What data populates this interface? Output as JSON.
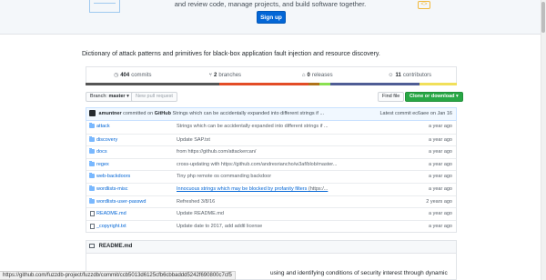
{
  "banner": {
    "text": "and review code, manage projects, and build software together.",
    "signup_label": "Sign up"
  },
  "description": "Dictionary of attack patterns and primitives for black-box application fault injection and resource discovery.",
  "stats": {
    "commits_count": "404",
    "commits_label": "commits",
    "branches_count": "2",
    "branches_label": "branches",
    "releases_count": "0",
    "releases_label": "releases",
    "contributors_count": "11",
    "contributors_label": "contributors"
  },
  "language_colors": [
    "#555555",
    "#e34c26",
    "#b07219",
    "#89e051",
    "#4F5D95",
    "#f1e05a"
  ],
  "toolbar": {
    "branch_label": "Branch:",
    "branch_value": "master",
    "new_pr_label": "New pull request",
    "find_file_label": "Find file",
    "clone_label": "Clone or download"
  },
  "latest_commit": {
    "author": "amuntner",
    "committed_text": "committed on",
    "via": "GitHub",
    "message": "Strings which can be accidentally expanded into different strings if ...",
    "latest_label": "Latest commit",
    "sha": "ec6aee",
    "date": "on Jan 16"
  },
  "files": [
    {
      "name": "attack",
      "type": "dir",
      "message": "Strings which can be accidentally expanded into different strings if ...",
      "age": "a year ago"
    },
    {
      "name": "discovery",
      "type": "dir",
      "message": "Update SAP.txt",
      "age": "a year ago"
    },
    {
      "name": "docs",
      "type": "dir",
      "message": "from https://github.com/attackercan/",
      "age": "a year ago"
    },
    {
      "name": "regex",
      "type": "dir",
      "message": "cross-updating with https://github.com/andresriancho/w3af/blob/master...",
      "age": "a year ago"
    },
    {
      "name": "web-backdoors",
      "type": "dir",
      "message": "Tiny php remote os commanding backdoor",
      "age": "a year ago"
    },
    {
      "name": "wordlists-misc",
      "type": "dir",
      "message": "Innocuous strings which may be blocked by profanity filters",
      "message_rest": " (https:/...",
      "age": "a year ago",
      "link": true
    },
    {
      "name": "wordlists-user-passwd",
      "type": "dir",
      "message": "Refreshed 3/8/16",
      "age": "2 years ago"
    },
    {
      "name": "README.md",
      "type": "file",
      "message": "Update README.md",
      "age": "a year ago"
    },
    {
      "name": "_copyright.txt",
      "type": "file",
      "message": "Update date to 2017, add addtl license",
      "age": "a year ago"
    }
  ],
  "readme": {
    "title": "README.md",
    "body_text": "using and identifying conditions of security interest through dynamic"
  },
  "status_url": "https://github.com/fuzzdb-project/fuzzdb/commit/ccb5013d6125cfb6cbbaddd5242f690800c7cf5"
}
